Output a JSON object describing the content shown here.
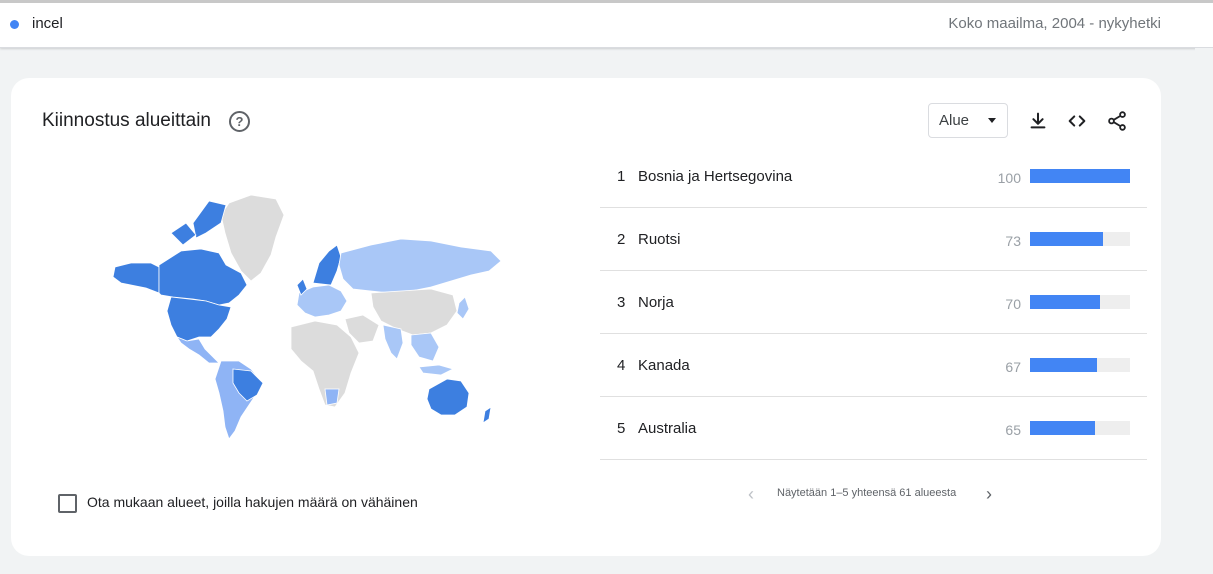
{
  "term": {
    "label": "incel",
    "color": "#4285f4",
    "scope": "Koko maailma, 2004 - nykyhetki"
  },
  "card": {
    "title": "Kiinnostus alueittain",
    "help_icon": "?"
  },
  "region_select": {
    "value": "Alue"
  },
  "icons": {
    "download": "download-icon",
    "embed": "embed-code-icon",
    "share": "share-icon"
  },
  "colors": {
    "bar": "#4285f4",
    "map_strong": "#3d7fe0",
    "map_medium": "#8fb4f5",
    "map_light": "#a9c7f7",
    "map_none": "#dcdcdc"
  },
  "rankings": [
    {
      "rank": "1",
      "name": "Bosnia ja Hertsegovina",
      "value": "100",
      "fill": 100
    },
    {
      "rank": "2",
      "name": "Ruotsi",
      "value": "73",
      "fill": 73
    },
    {
      "rank": "3",
      "name": "Norja",
      "value": "70",
      "fill": 70
    },
    {
      "rank": "4",
      "name": "Kanada",
      "value": "67",
      "fill": 67
    },
    {
      "rank": "5",
      "name": "Australia",
      "value": "65",
      "fill": 65
    }
  ],
  "low_volume": {
    "label": "Ota mukaan alueet, joilla hakujen määrä on vähäinen",
    "checked": false
  },
  "pager": {
    "text": "Näytetään 1–5 yhteensä 61 alueesta"
  }
}
